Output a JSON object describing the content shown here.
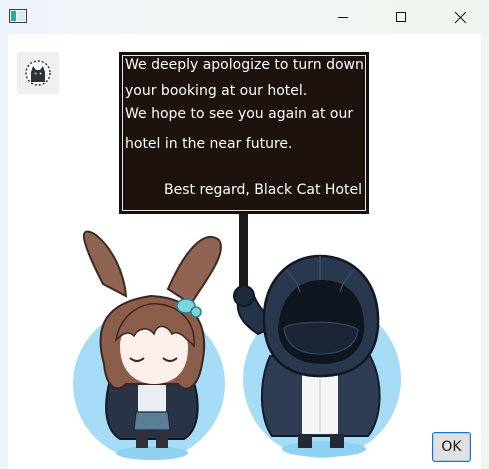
{
  "window": {
    "controls": {
      "minimize": "minimize-icon",
      "maximize": "maximize-icon",
      "close": "close-icon"
    }
  },
  "dialog": {
    "avatar_icon": "black-cat-logo",
    "sign": {
      "line1": "We deeply apologize to turn down",
      "line2": "your booking at our  hotel.",
      "line3": "We hope to see you again at our",
      "line4": "hotel in the near future.",
      "signature": "Best regard, Black Cat Hotel"
    },
    "ok_label": "OK"
  },
  "colors": {
    "sign_background": "#1e120f",
    "sign_text": "#ffffff",
    "ok_border": "#1a73c9",
    "character_halo": "#a6dcf5"
  }
}
